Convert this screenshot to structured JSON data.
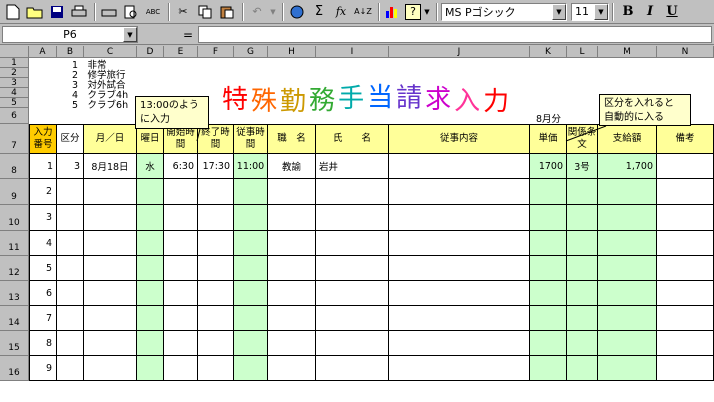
{
  "toolbar": {
    "font_name": "MS Pゴシック",
    "font_size": "11",
    "bold": "B",
    "italic": "I",
    "underline": "U",
    "sigma": "Σ",
    "fx": "fx"
  },
  "formula": {
    "cell_ref": "P6",
    "eq": "="
  },
  "columns": [
    "A",
    "B",
    "C",
    "D",
    "E",
    "F",
    "G",
    "H",
    "I",
    "J",
    "K",
    "L",
    "M",
    "N"
  ],
  "rows": [
    "1",
    "2",
    "3",
    "4",
    "5",
    "6",
    "7",
    "8",
    "9",
    "10",
    "11",
    "12",
    "13",
    "14",
    "15",
    "16"
  ],
  "legend": [
    "1　非常",
    "2　修学旅行",
    "3　対外試合",
    "4　クラブ4h",
    "5　クラブ6h"
  ],
  "title": "特殊勤務手当請求入力",
  "title_colors": [
    "#ff0000",
    "#ff6600",
    "#cc9900",
    "#33aa33",
    "#00aaaa",
    "#0066ff",
    "#6633cc",
    "#cc00cc",
    "#ff3399",
    "#ff0000"
  ],
  "month_label": "8月分",
  "callout_left": "13:00のように入力",
  "callout_right": [
    "区分を入れると",
    "自動的に入る"
  ],
  "headers": {
    "input_no": "入力番号",
    "kubun": "区分",
    "date": "月／日",
    "weekday": "曜日",
    "start": "開始時間",
    "end": "終了時間",
    "work_time": "従事時間",
    "position": "職　名",
    "name": "氏　　名",
    "content": "従事内容",
    "unit_price": "単価",
    "article": "関係条文",
    "amount": "支給額",
    "remarks": "備考"
  },
  "record": {
    "no": "1",
    "kubun": "3",
    "date": "8月18日",
    "weekday": "水",
    "start": "6:30",
    "end": "17:30",
    "work_time": "11:00",
    "position": "教諭",
    "name": "岩井",
    "content": "",
    "unit_price": "1700",
    "article": "3号",
    "amount": "1,700"
  },
  "row_numbers": [
    "2",
    "3",
    "4",
    "5",
    "6",
    "7",
    "8",
    "9"
  ]
}
